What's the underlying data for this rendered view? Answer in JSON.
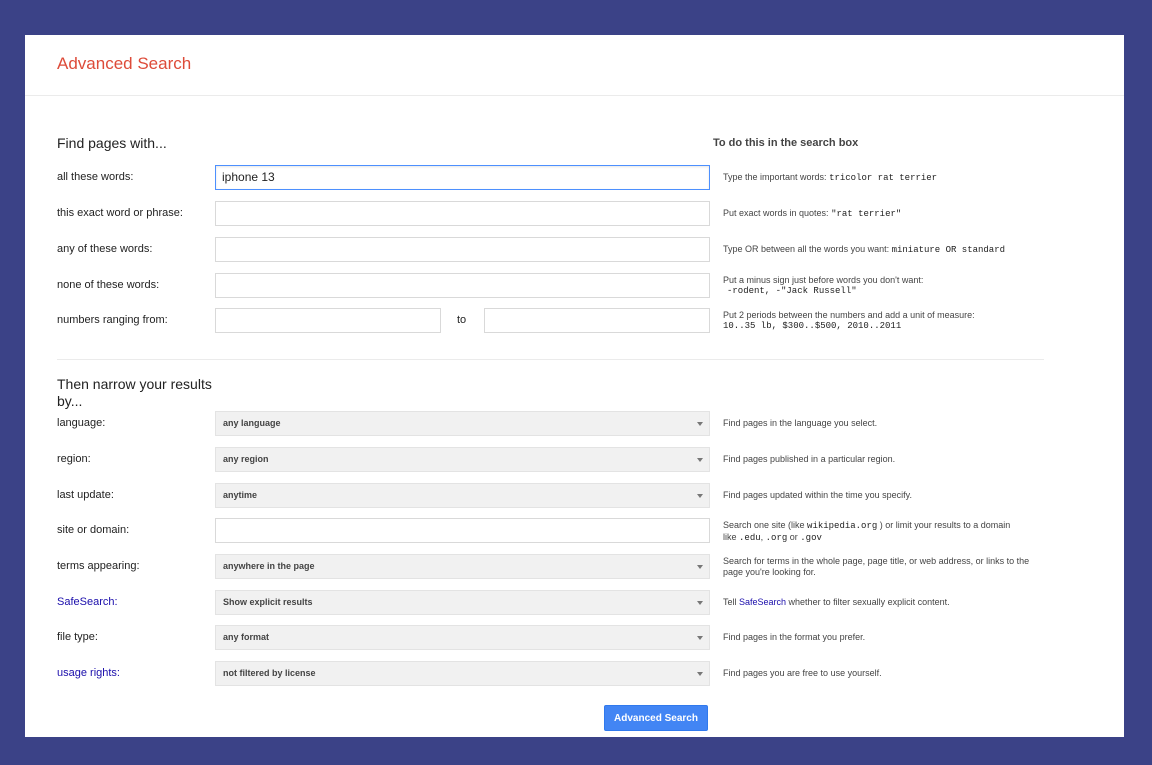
{
  "header": {
    "title": "Advanced Search"
  },
  "find": {
    "heading": "Find pages with...",
    "hint_heading": "To do this in the search box",
    "all_words": {
      "label": "all these words:",
      "value": "iphone 13",
      "hint_text": "Type the important words: ",
      "hint_example": "tricolor rat terrier"
    },
    "exact_phrase": {
      "label": "this exact word or phrase:",
      "value": "",
      "hint_text": "Put exact words in quotes: ",
      "hint_example": "\"rat terrier\""
    },
    "any_words": {
      "label": "any of these words:",
      "value": "",
      "hint_text": "Type OR between all the words you want: ",
      "hint_example": "miniature OR standard"
    },
    "none_words": {
      "label": "none of these words:",
      "value": "",
      "hint_text": "Put a minus sign just before words you don't want:",
      "hint_example": "-rodent, -\"Jack Russell\""
    },
    "numbers": {
      "label": "numbers ranging from:",
      "from_value": "",
      "to_label": "to",
      "to_value": "",
      "hint_text": "Put 2 periods between the numbers and add a unit of measure:",
      "hint_example": "10..35 lb, $300..$500, 2010..2011"
    }
  },
  "narrow": {
    "heading_line1": "Then narrow your results",
    "heading_line2": "by...",
    "language": {
      "label": "language:",
      "selected": "any language",
      "hint": "Find pages in the language you select."
    },
    "region": {
      "label": "region:",
      "selected": "any region",
      "hint": "Find pages published in a particular region."
    },
    "last_update": {
      "label": "last update:",
      "selected": "anytime",
      "hint": "Find pages updated within the time you specify."
    },
    "site": {
      "label": "site or domain:",
      "value": "",
      "hint_a": "Search one site (like ",
      "hint_ex1": "wikipedia.org",
      "hint_b": " ) or limit your results to a domain",
      "hint_c": "like ",
      "hint_ex2": ".edu",
      "hint_d": ", ",
      "hint_ex3": ".org",
      "hint_e": " or ",
      "hint_ex4": ".gov"
    },
    "terms": {
      "label": "terms appearing:",
      "selected": "anywhere in the page",
      "hint": "Search for terms in the whole page, page title, or web address, or links to the page you're looking for."
    },
    "safesearch": {
      "label": "SafeSearch:",
      "selected": "Show explicit results",
      "hint_a": "Tell ",
      "hint_link": "SafeSearch",
      "hint_b": " whether to filter sexually explicit content."
    },
    "file_type": {
      "label": "file type:",
      "selected": "any format",
      "hint": "Find pages in the format you prefer."
    },
    "usage_rights": {
      "label": "usage rights:",
      "selected": "not filtered by license",
      "hint": "Find pages you are free to use yourself."
    }
  },
  "submit": {
    "label": "Advanced Search"
  },
  "colors": {
    "background": "#3b4287",
    "title": "#dd4b39",
    "link": "#1a0dab",
    "button": "#4285f4"
  }
}
